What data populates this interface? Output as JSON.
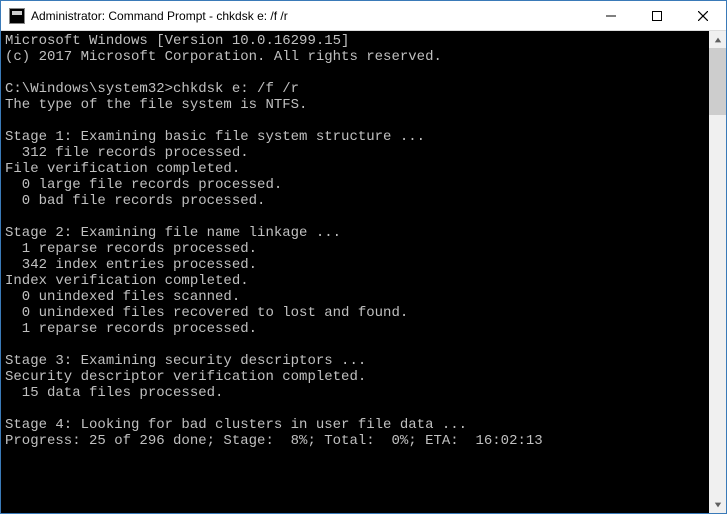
{
  "titlebar": {
    "title": "Administrator: Command Prompt - chkdsk  e: /f /r"
  },
  "console": {
    "lines": [
      "Microsoft Windows [Version 10.0.16299.15]",
      "(c) 2017 Microsoft Corporation. All rights reserved.",
      "",
      "C:\\Windows\\system32>chkdsk e: /f /r",
      "The type of the file system is NTFS.",
      "",
      "Stage 1: Examining basic file system structure ...",
      "  312 file records processed.",
      "File verification completed.",
      "  0 large file records processed.",
      "  0 bad file records processed.",
      "",
      "Stage 2: Examining file name linkage ...",
      "  1 reparse records processed.",
      "  342 index entries processed.",
      "Index verification completed.",
      "  0 unindexed files scanned.",
      "  0 unindexed files recovered to lost and found.",
      "  1 reparse records processed.",
      "",
      "Stage 3: Examining security descriptors ...",
      "Security descriptor verification completed.",
      "  15 data files processed.",
      "",
      "Stage 4: Looking for bad clusters in user file data ...",
      "Progress: 25 of 296 done; Stage:  8%; Total:  0%; ETA:  16:02:13"
    ]
  }
}
